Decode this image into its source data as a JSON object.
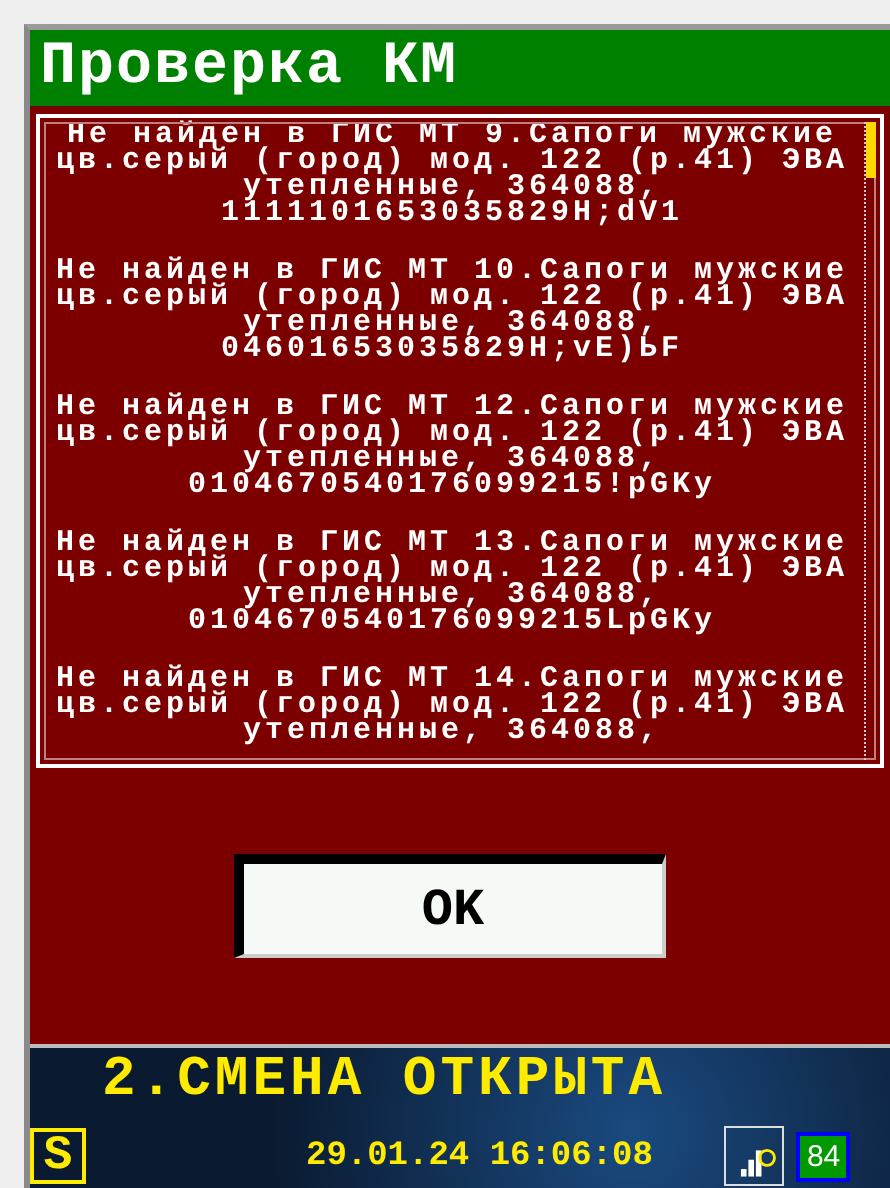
{
  "window": {
    "title": "Проверка КМ"
  },
  "messages": [
    "Не найден в ГИС МТ 9.Сапоги мужские цв.серый (город) мод. 122 (р.41) ЭВА утепленные, 364088, 1111101653035829H;dV1",
    "Не найден в ГИС МТ 10.Сапоги мужские цв.серый (город) мод. 122 (р.41) ЭВА утепленные, 364088, 04601653035829H;vE)ЬF",
    "Не найден в ГИС МТ 12.Сапоги мужские цв.серый (город) мод. 122 (р.41) ЭВА утепленные, 364088, 0104670540176099215!pGKy",
    "Не найден в ГИС МТ 13.Сапоги мужские цв.серый (город) мод. 122 (р.41) ЭВА утепленные, 364088, 0104670540176099215LpGKy",
    "Не найден в ГИС МТ 14.Сапоги мужские цв.серый (город) мод. 122 (р.41) ЭВА утепленные, 364088,"
  ],
  "buttons": [
    {
      "label": "OK"
    }
  ],
  "status_bar": {
    "shift_status": "2.СМЕНА ОТКРЫТА",
    "mode": "S",
    "datetime": "29.01.24 16:06:08",
    "battery": "84"
  }
}
